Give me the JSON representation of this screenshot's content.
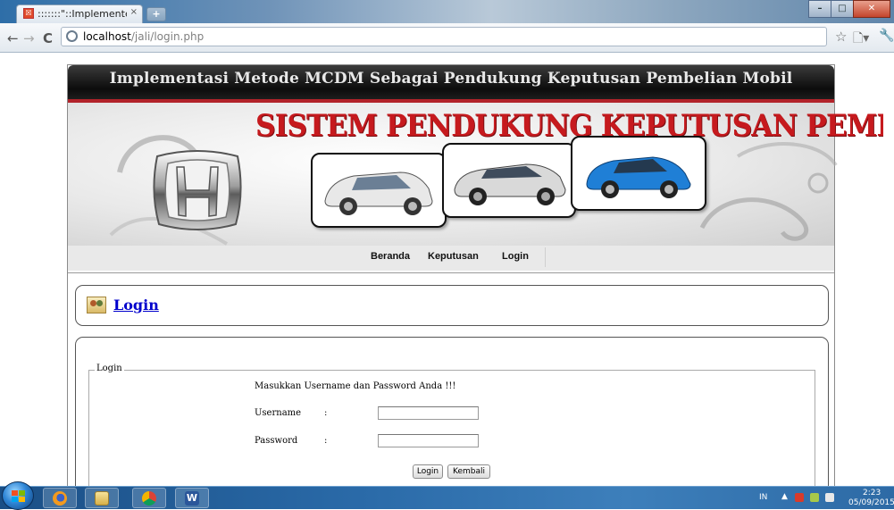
{
  "browser": {
    "tab_title": ":::::::\"::Implementelasi Me...",
    "tab_close": "×",
    "new_tab": "+",
    "url_host": "localhost",
    "url_path": "/jali/login.php",
    "icons": {
      "back": "left-arrow-icon",
      "forward": "right-arrow-icon",
      "reload": "reload-icon",
      "page_icon": "globe-icon",
      "bookmark": "star-icon",
      "page_menu": "page-icon",
      "settings": "wrench-icon"
    }
  },
  "site": {
    "top_title": "Implementasi Metode MCDM Sebagai Pendukung Keputusan Pembelian Mobil",
    "banner_title": "SISTEM PENDUKUNG KEPUTUSAN PEMBELIAN MOBIL",
    "brand": "honda-logo",
    "accent_color": "#c61a1e",
    "nav": [
      {
        "label": "Beranda"
      },
      {
        "label": "Keputusan"
      },
      {
        "label": "Login"
      }
    ]
  },
  "login_panel": {
    "heading": "Login",
    "legend": "Login",
    "instruction": "Masukkan Username dan Password Anda !!!",
    "username_label": "Username",
    "password_label": "Password",
    "colon": ":",
    "username_value": "",
    "password_value": "",
    "login_button": "Login",
    "back_button": "Kembali"
  },
  "taskbar": {
    "apps": [
      "windows-start-icon",
      "firefox-icon",
      "file-explorer-icon",
      "chrome-icon",
      "word-icon"
    ],
    "language": "IN",
    "time": "2:23",
    "date": "05/09/2015"
  }
}
